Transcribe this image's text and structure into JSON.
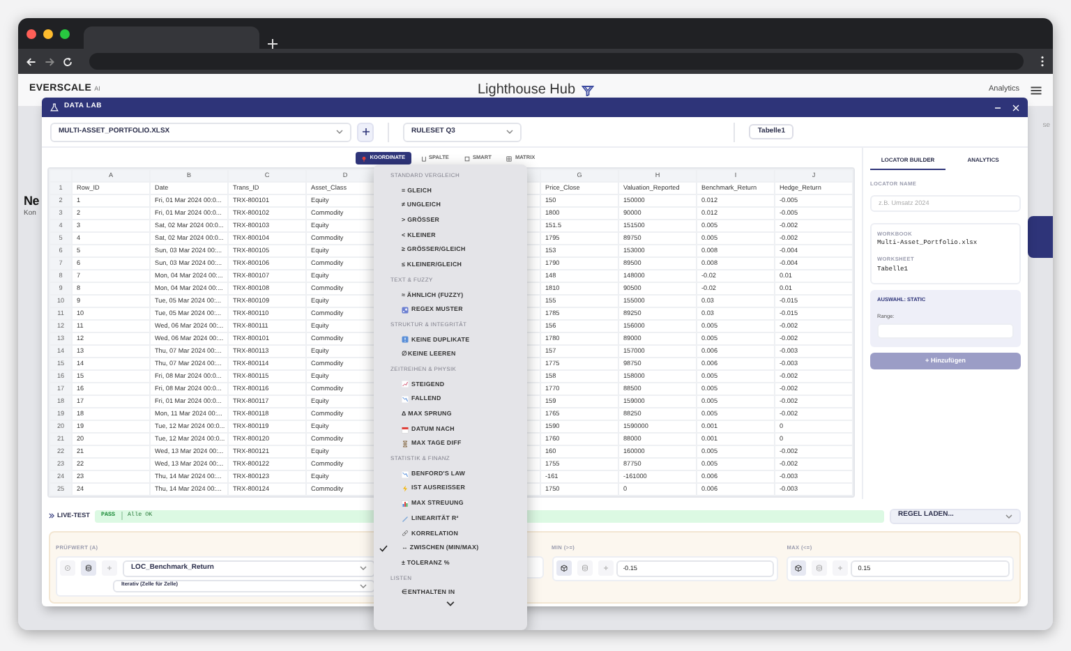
{
  "app_header": {
    "brand": "EVERSCALE",
    "brand_badge": "AI",
    "title": "Lighthouse Hub",
    "nav_link": "Analytics"
  },
  "background": {
    "heading": "Ne",
    "subtext": "Kon",
    "right_text": "se"
  },
  "modal": {
    "title": "DATA LAB"
  },
  "toolbar": {
    "workbook": "MULTI-ASSET_PORTFOLIO.XLSX",
    "ruleset": "RULESET Q3",
    "sheet": "Tabelle1"
  },
  "view_tabs": [
    {
      "label": "KOORDINATE",
      "kind": "pin",
      "selected": true
    },
    {
      "label": "SPALTE",
      "kind": "column",
      "selected": false
    },
    {
      "label": "SMART",
      "kind": "smart",
      "selected": false
    },
    {
      "label": "MATRIX",
      "kind": "grid",
      "selected": false
    }
  ],
  "table": {
    "columns": [
      "A",
      "B",
      "C",
      "D",
      "G",
      "H",
      "I",
      "J"
    ],
    "rows": [
      {
        "num": "1",
        "cells": [
          "Row_ID",
          "Date",
          "Trans_ID",
          "Asset_Class",
          "Price_Close",
          "Valuation_Reported",
          "Benchmark_Return",
          "Hedge_Return"
        ]
      },
      {
        "num": "2",
        "cells": [
          "1",
          "Fri, 01 Mar 2024 00:0...",
          "TRX-800101",
          "Equity",
          "150",
          "150000",
          "0.012",
          "-0.005"
        ]
      },
      {
        "num": "3",
        "cells": [
          "2",
          "Fri, 01 Mar 2024 00:0...",
          "TRX-800102",
          "Commodity",
          "1800",
          "90000",
          "0.012",
          "-0.005"
        ]
      },
      {
        "num": "4",
        "cells": [
          "3",
          "Sat, 02 Mar 2024 00:0...",
          "TRX-800103",
          "Equity",
          "151.5",
          "151500",
          "0.005",
          "-0.002"
        ]
      },
      {
        "num": "5",
        "cells": [
          "4",
          "Sat, 02 Mar 2024 00:0...",
          "TRX-800104",
          "Commodity",
          "1795",
          "89750",
          "0.005",
          "-0.002"
        ]
      },
      {
        "num": "6",
        "cells": [
          "5",
          "Sun, 03 Mar 2024 00:...",
          "TRX-800105",
          "Equity",
          "153",
          "153000",
          "0.008",
          "-0.004"
        ]
      },
      {
        "num": "7",
        "cells": [
          "6",
          "Sun, 03 Mar 2024 00:...",
          "TRX-800106",
          "Commodity",
          "1790",
          "89500",
          "0.008",
          "-0.004"
        ]
      },
      {
        "num": "8",
        "cells": [
          "7",
          "Mon, 04 Mar 2024 00:...",
          "TRX-800107",
          "Equity",
          "148",
          "148000",
          "-0.02",
          "0.01"
        ]
      },
      {
        "num": "9",
        "cells": [
          "8",
          "Mon, 04 Mar 2024 00:...",
          "TRX-800108",
          "Commodity",
          "1810",
          "90500",
          "-0.02",
          "0.01"
        ]
      },
      {
        "num": "10",
        "cells": [
          "9",
          "Tue, 05 Mar 2024 00:...",
          "TRX-800109",
          "Equity",
          "155",
          "155000",
          "0.03",
          "-0.015"
        ]
      },
      {
        "num": "11",
        "cells": [
          "10",
          "Tue, 05 Mar 2024 00:...",
          "TRX-800110",
          "Commodity",
          "1785",
          "89250",
          "0.03",
          "-0.015"
        ]
      },
      {
        "num": "12",
        "cells": [
          "11",
          "Wed, 06 Mar 2024 00:...",
          "TRX-800111",
          "Equity",
          "156",
          "156000",
          "0.005",
          "-0.002"
        ]
      },
      {
        "num": "13",
        "cells": [
          "12",
          "Wed, 06 Mar 2024 00:...",
          "TRX-800101",
          "Commodity",
          "1780",
          "89000",
          "0.005",
          "-0.002"
        ]
      },
      {
        "num": "14",
        "cells": [
          "13",
          "Thu, 07 Mar 2024 00:...",
          "TRX-800113",
          "Equity",
          "157",
          "157000",
          "0.006",
          "-0.003"
        ]
      },
      {
        "num": "15",
        "cells": [
          "14",
          "Thu, 07 Mar 2024 00:...",
          "TRX-800114",
          "Commodity",
          "1775",
          "98750",
          "0.006",
          "-0.003"
        ]
      },
      {
        "num": "16",
        "cells": [
          "15",
          "Fri, 08 Mar 2024 00:0...",
          "TRX-800115",
          "Equity",
          "158",
          "158000",
          "0.005",
          "-0.002"
        ]
      },
      {
        "num": "17",
        "cells": [
          "16",
          "Fri, 08 Mar 2024 00:0...",
          "TRX-800116",
          "Commodity",
          "1770",
          "88500",
          "0.005",
          "-0.002"
        ]
      },
      {
        "num": "18",
        "cells": [
          "17",
          "Fri, 01 Mar 2024 00:0...",
          "TRX-800117",
          "Equity",
          "159",
          "159000",
          "0.005",
          "-0.002"
        ]
      },
      {
        "num": "19",
        "cells": [
          "18",
          "Mon, 11 Mar 2024 00:...",
          "TRX-800118",
          "Commodity",
          "1765",
          "88250",
          "0.005",
          "-0.002"
        ]
      },
      {
        "num": "20",
        "cells": [
          "19",
          "Tue, 12 Mar 2024 00:0...",
          "TRX-800119",
          "Equity",
          "1590",
          "1590000",
          "0.001",
          "0"
        ]
      },
      {
        "num": "21",
        "cells": [
          "20",
          "Tue, 12 Mar 2024 00:0...",
          "TRX-800120",
          "Commodity",
          "1760",
          "88000",
          "0.001",
          "0"
        ]
      },
      {
        "num": "22",
        "cells": [
          "21",
          "Wed, 13 Mar 2024 00:...",
          "TRX-800121",
          "Equity",
          "160",
          "160000",
          "0.005",
          "-0.002"
        ]
      },
      {
        "num": "23",
        "cells": [
          "22",
          "Wed, 13 Mar 2024 00:...",
          "TRX-800122",
          "Commodity",
          "1755",
          "87750",
          "0.005",
          "-0.002"
        ]
      },
      {
        "num": "24",
        "cells": [
          "23",
          "Thu, 14 Mar 2024 00:...",
          "TRX-800123",
          "Equity",
          "-161",
          "-161000",
          "0.006",
          "-0.003"
        ]
      },
      {
        "num": "25",
        "cells": [
          "24",
          "Thu, 14 Mar 2024 00:...",
          "TRX-800124",
          "Commodity",
          "1750",
          "0",
          "0.006",
          "-0.003"
        ]
      }
    ]
  },
  "menu": {
    "sections": [
      {
        "title": "STANDARD VERGLEICH",
        "items": [
          {
            "label": "= GLEICH",
            "kind": "text",
            "checked": false
          },
          {
            "label": "≠ UNGLEICH",
            "kind": "text",
            "checked": false
          },
          {
            "label": "> GRÖSSER",
            "kind": "text",
            "checked": false
          },
          {
            "label": "< KLEINER",
            "kind": "text",
            "checked": false
          },
          {
            "label": "≥ GRÖSSER/GLEICH",
            "kind": "text",
            "checked": false
          },
          {
            "label": "≤ KLEINER/GLEICH",
            "kind": "text",
            "checked": false
          }
        ]
      },
      {
        "title": "TEXT & FUZZY",
        "items": [
          {
            "label": "≈ ÄHNLICH (FUZZY)",
            "kind": "text",
            "checked": false
          },
          {
            "label": "REGEX MUSTER",
            "kind": "regex",
            "checked": false
          }
        ]
      },
      {
        "title": "STRUKTUR & INTEGRITÄT",
        "items": [
          {
            "label": "KEINE DUPLIKATE",
            "kind": "duplicate",
            "checked": false
          },
          {
            "label": "∅ KEINE LEEREN",
            "kind": "text",
            "checked": false
          }
        ]
      },
      {
        "title": "ZEITREIHEN & PHYSIK",
        "items": [
          {
            "label": "STEIGEND",
            "kind": "rising",
            "checked": false
          },
          {
            "label": "FALLEND",
            "kind": "falling",
            "checked": false
          },
          {
            "label": "Δ MAX SPRUNG",
            "kind": "text",
            "checked": false
          },
          {
            "label": "DATUM NACH",
            "kind": "calendar",
            "checked": false
          },
          {
            "label": "MAX TAGE DIFF",
            "kind": "hourglass",
            "checked": false
          }
        ]
      },
      {
        "title": "STATISTIK & FINANZ",
        "items": [
          {
            "label": "BENFORD'S LAW",
            "kind": "falling",
            "checked": false
          },
          {
            "label": "IST AUSREISSER",
            "kind": "bolt",
            "checked": false
          },
          {
            "label": "MAX STREUUNG",
            "kind": "bars",
            "checked": false
          },
          {
            "label": "LINEARITÄT R²",
            "kind": "ruler",
            "checked": false
          },
          {
            "label": "KORRELATION",
            "kind": "link",
            "checked": false
          },
          {
            "label": "↔ ZWISCHEN (MIN/MAX)",
            "kind": "text",
            "checked": true
          },
          {
            "label": "± TOLERANZ %",
            "kind": "text",
            "checked": false
          }
        ]
      },
      {
        "title": "LISTEN",
        "items": [
          {
            "label": "∈ ENTHALTEN IN",
            "kind": "text",
            "checked": false
          }
        ]
      }
    ]
  },
  "side_panel": {
    "tabs": [
      {
        "label": "LOCATOR BUILDER",
        "selected": true
      },
      {
        "label": "ANALYTICS",
        "selected": false
      }
    ],
    "name_label": "LOCATOR NAME",
    "name_placeholder": "z.B. Umsatz 2024",
    "workbook_label": "WORKBOOK",
    "workbook": "Multi-Asset_Portfolio.xlsx",
    "worksheet_label": "WORKSHEET",
    "worksheet": "Tabelle1",
    "selection_title": "AUSWAHL: STATIC",
    "range_label": "Range:",
    "add_button": "+ Hinzufügen",
    "add_disabled": true
  },
  "live_test": {
    "label": "LIVE-TEST",
    "status": "PASS",
    "message": "Alle OK",
    "load_rules": "REGEL LADEN..."
  },
  "rule": {
    "operand": {
      "label": "PRÜFWERT (A)",
      "value": "LOC_Benchmark_Return",
      "mode": "Iterativ (Zelle für Zelle)",
      "sources": [
        {
          "kind": "target",
          "selected": false
        },
        {
          "kind": "database",
          "selected": true
        },
        {
          "kind": "plus",
          "selected": false
        }
      ]
    },
    "bounds": [
      {
        "label": "MIN (>=)",
        "value": "-0.15",
        "sources": [
          {
            "kind": "cube",
            "selected": true
          },
          {
            "kind": "database",
            "selected": false
          },
          {
            "kind": "plus",
            "selected": false
          }
        ]
      },
      {
        "label": "MAX (<=)",
        "value": "0.15",
        "sources": [
          {
            "kind": "cube",
            "selected": true
          },
          {
            "kind": "database",
            "selected": false
          },
          {
            "kind": "plus",
            "selected": false
          }
        ]
      }
    ]
  }
}
